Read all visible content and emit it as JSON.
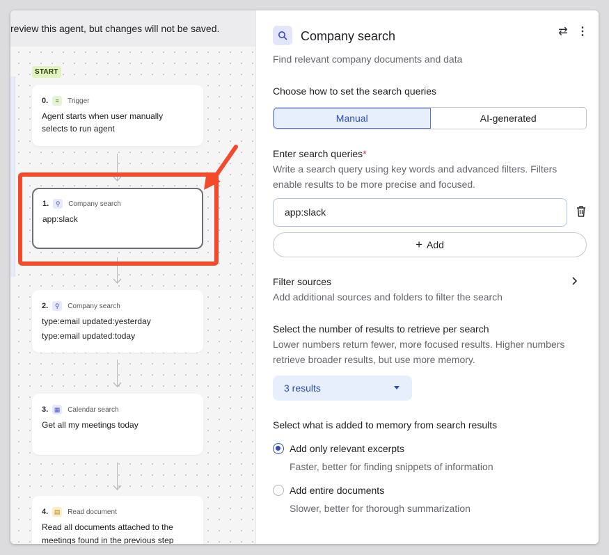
{
  "canvas": {
    "banner_text": "review this agent, but changes will not be saved.",
    "start_label": "START",
    "steps": [
      {
        "num": "0.",
        "type": "Trigger",
        "icon": "list-icon",
        "lines": [
          "Agent starts when user manually",
          "selects to run agent"
        ]
      },
      {
        "num": "1.",
        "type": "Company search",
        "icon": "search-icon",
        "lines": [
          "app:slack"
        ]
      },
      {
        "num": "2.",
        "type": "Company search",
        "icon": "search-icon",
        "lines": [
          "type:email updated:yesterday",
          "type:email updated:today"
        ]
      },
      {
        "num": "3.",
        "type": "Calendar search",
        "icon": "calendar-icon",
        "lines": [
          "Get all my meetings today"
        ]
      },
      {
        "num": "4.",
        "type": "Read document",
        "icon": "document-icon",
        "lines": [
          "Read all documents attached to the",
          "meetings found in the previous step"
        ]
      }
    ],
    "highlight_color": "#f24a2a"
  },
  "panel": {
    "title": "Company search",
    "description": "Find relevant company documents and data",
    "query_mode": {
      "label": "Choose how to set the search queries",
      "options": [
        "Manual",
        "AI-generated"
      ],
      "selected": "Manual"
    },
    "queries": {
      "label": "Enter search queries",
      "required_mark": "*",
      "help": "Write a search query using key words and advanced filters. Filters enable results to be more precise and focused.",
      "value": "app:slack",
      "add_label": "Add",
      "add_symbol": "+"
    },
    "filter_sources": {
      "label": "Filter sources",
      "help": "Add additional sources and folders to filter the search"
    },
    "results": {
      "label": "Select the number of results to retrieve per search",
      "help": "Lower numbers return fewer, more focused results. Higher numbers retrieve broader results, but use more memory.",
      "selected": "3 results"
    },
    "memory": {
      "label": "Select what is added to memory from search results",
      "options": [
        {
          "label": "Add only relevant excerpts",
          "help": "Faster, better for finding snippets of information",
          "checked": true
        },
        {
          "label": "Add entire documents",
          "help": "Slower, better for thorough summarization",
          "checked": false
        }
      ]
    }
  },
  "colors": {
    "accent": "#2b4fb6",
    "accent_bg": "#e7eefc",
    "highlight": "#f24a2a",
    "start_badge_bg": "#e4f2c2"
  }
}
